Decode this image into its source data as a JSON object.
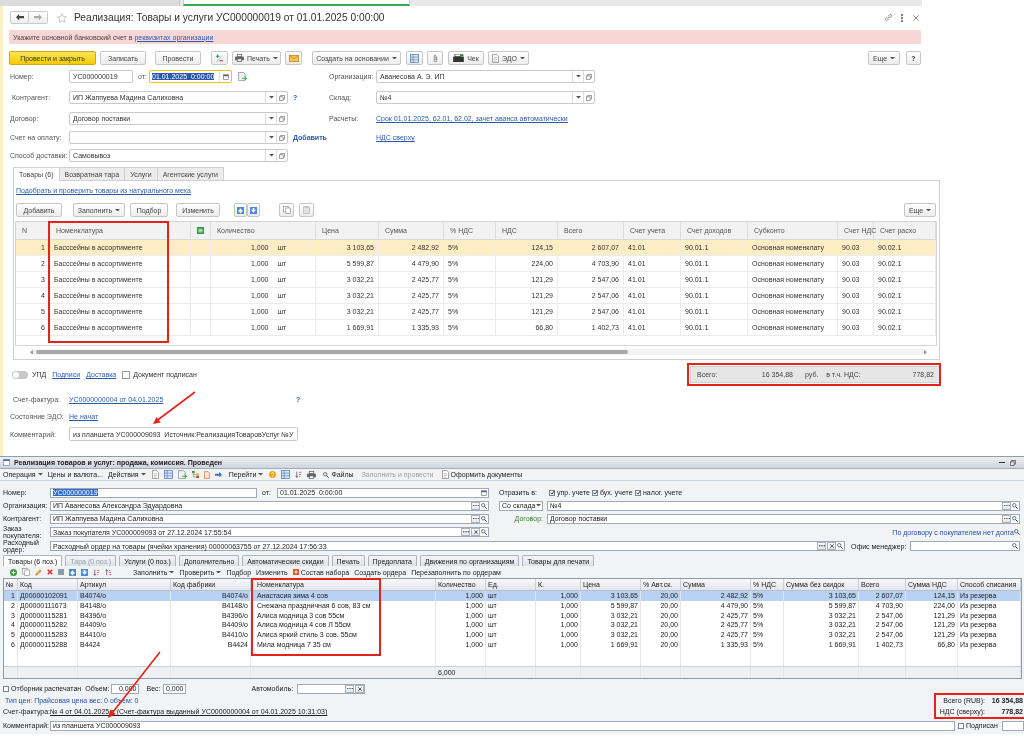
{
  "browser_tabs": [
    {
      "selected": false
    },
    {
      "selected": true
    }
  ],
  "document": {
    "title": "Реализация: Товары и услуги УС000000019 от 01.01.2025 0:00:00",
    "warning": {
      "text": "Укажите основной банковский счет в",
      "link": "реквизитах организации"
    },
    "toolbar": {
      "post_and_close": "Провести и закрыть",
      "save": "Записать",
      "post": "Провести",
      "print": "Печать",
      "create_based_on": "Создать на основании",
      "receipt": "Чек",
      "edo": "ЭДО",
      "more": "Еще",
      "help": "?"
    },
    "fields": {
      "number": {
        "label": "Номер:",
        "value": "УС000000019"
      },
      "date": {
        "label": "от:",
        "value": "01.01.2025  0:00:00",
        "focused": true
      },
      "organization": {
        "label": "Организация:",
        "value": "Аванесова А. Э. ИП"
      },
      "counterparty": {
        "label": "Контрагент:",
        "value": "ИП Жаппуева Мадина Салиховна",
        "help": "?"
      },
      "warehouse": {
        "label": "Склад:",
        "value": "№4"
      },
      "contract": {
        "label": "Договор:",
        "value": "Договор поставки"
      },
      "settlements": {
        "label": "Расчеты:",
        "link": "Срок 01.01.2025, 62.01, 62.02, зачет аванса автоматически"
      },
      "payment_invoice": {
        "label": "Счет на оплату:",
        "link": "Добавить"
      },
      "vat_mode_link": "НДС сверху",
      "delivery": {
        "label": "Способ доставки:",
        "value": "Самовывоз"
      }
    },
    "tabs": [
      {
        "label": "Товары (6)",
        "selected": true
      },
      {
        "label": "Возвратная тара",
        "selected": false
      },
      {
        "label": "Услуги",
        "selected": false
      },
      {
        "label": "Агентские услуги",
        "selected": false
      }
    ],
    "fur_link": "Подобрать и проверить товары из натурального меха",
    "table_toolbar": {
      "add": "Добавить",
      "fill": "Заполнить",
      "pick": "Подбор",
      "change": "Изменить",
      "more": "Еще"
    },
    "table": {
      "columns": [
        "N",
        "Номенклатура",
        "Количество",
        "Цена",
        "Сумма",
        "% НДС",
        "НДС",
        "Всего",
        "Счет учета",
        "Счет доходов",
        "Субконто",
        "Счет НДС",
        "Счет расхо"
      ],
      "rows": [
        {
          "selected": true,
          "cells": [
            "1",
            "Басссейны в ассортименте",
            "1,000 шт",
            "3 103,65",
            "2 482,92",
            "5%",
            "124,15",
            "2 607,07",
            "41.01",
            "90.01.1",
            "Основная номенклату",
            "90.03",
            "90.02.1"
          ]
        },
        {
          "selected": false,
          "cells": [
            "2",
            "Басссейны в ассортименте",
            "1,000 шт",
            "5 599,87",
            "4 479,90",
            "5%",
            "224,00",
            "4 703,90",
            "41.01",
            "90.01.1",
            "Основная номенклату",
            "90.03",
            "90.02.1"
          ]
        },
        {
          "selected": false,
          "cells": [
            "3",
            "Басссейны в ассортименте",
            "1,000 шт",
            "3 032,21",
            "2 425,77",
            "5%",
            "121,29",
            "2 547,06",
            "41.01",
            "90.01.1",
            "Основная номенклату",
            "90.03",
            "90.02.1"
          ]
        },
        {
          "selected": false,
          "cells": [
            "4",
            "Басссейны в ассортименте",
            "1,000 шт",
            "3 032,21",
            "2 425,77",
            "5%",
            "121,29",
            "2 547,06",
            "41.01",
            "90.01.1",
            "Основная номенклату",
            "90.03",
            "90.02.1"
          ]
        },
        {
          "selected": false,
          "cells": [
            "5",
            "Басссейны в ассортименте",
            "1,000 шт",
            "3 032,21",
            "2 425,77",
            "5%",
            "121,29",
            "2 547,06",
            "41.01",
            "90.01.1",
            "Основная номенклату",
            "90.03",
            "90.02.1"
          ]
        },
        {
          "selected": false,
          "cells": [
            "6",
            "Басссейны в ассортименте",
            "1,000 шт",
            "1 669,91",
            "1 335,93",
            "5%",
            "66,80",
            "1 402,73",
            "41.01",
            "90.01.1",
            "Основная номенклату",
            "90.03",
            "90.02.1"
          ]
        }
      ]
    },
    "upd": {
      "label": "УПД",
      "on": false
    },
    "signatures_link": "Подписи",
    "delivery_link": "Доставка",
    "signed": {
      "label": "Документ подписан",
      "checked": false
    },
    "totals": {
      "total_label": "Всего:",
      "total": "16 354,88",
      "currency": "руб.",
      "vat_label": "в т.ч. НДС:",
      "vat": "778,82"
    },
    "invoice": {
      "label": "Счет-фактура:",
      "link": "УС0000000004 от 04.01.2025",
      "help": "?"
    },
    "edo_status": {
      "label": "Состояние ЭДО:",
      "link": "Не начат"
    },
    "comment": {
      "label": "Комментарий:",
      "value": "из планшета УС000009093  Источник:РеализацияТоваровУслуг №У"
    }
  },
  "legacy_form": {
    "title": "Реализация товаров и услуг: продажа, комиссия. Проведен",
    "toolbar": {
      "operation": "Операция",
      "prices": "Цены и валюта...",
      "actions": "Действия",
      "go_to": "Перейти",
      "files": "Файлы",
      "fill_and_post": {
        "label": "Заполнить и провести",
        "disabled": true
      },
      "make_documents": "Оформить документы"
    },
    "fields": {
      "number": {
        "label": "Номер:",
        "value": "УС000000019",
        "focused": true
      },
      "date": {
        "label": "от:",
        "value": "01.01.2025  0:00:00"
      },
      "reflect": {
        "label": "Отразить в:",
        "options": [
          {
            "label": "упр. учете",
            "checked": true
          },
          {
            "label": "бух. учете",
            "checked": true
          },
          {
            "label": "налог. учете",
            "checked": true
          }
        ]
      },
      "organization": {
        "label": "Организация:",
        "value": "ИП Аванесова Александра Эдуардовна"
      },
      "warehouse": {
        "mode": "Со склада",
        "value": "№4"
      },
      "counterparty": {
        "label": "Контрагент:",
        "value": "ИП Жаппуева Мадина Салиховна"
      },
      "contract": {
        "label": "Договор:",
        "value": "Договор поставки"
      },
      "customer_order": {
        "label": "Заказ покупателя:",
        "value": "Заказ покупателя УС000009093 от 27.12.2024 17:55:54"
      },
      "debt_status": "По договору с покупателем нет долга",
      "expense_order": {
        "label": "Расходный ордер:",
        "value": "Расходный ордер на товары (ячейки хранения) 00000063755 от 27.12.2024 17:56:33"
      },
      "office_manager": {
        "label": "Офис менеджер:"
      }
    },
    "tabs": [
      {
        "label": "Товары (6 поз.)",
        "selected": true,
        "disabled": false
      },
      {
        "label": "Тара (0 поз.)",
        "selected": false,
        "disabled": true
      },
      {
        "label": "Услуги (0 поз.)",
        "selected": false,
        "disabled": false
      },
      {
        "label": "Дополнительно",
        "selected": false,
        "disabled": false
      },
      {
        "label": "Автоматические скидки",
        "selected": false,
        "disabled": false
      },
      {
        "label": "Печать",
        "selected": false,
        "disabled": false
      },
      {
        "label": "Предоплата",
        "selected": false,
        "disabled": false
      },
      {
        "label": "Движения по организациям",
        "selected": false,
        "disabled": false
      },
      {
        "label": "Товары для печати",
        "selected": false,
        "disabled": false
      }
    ],
    "table_toolbar": {
      "fill": "Заполнить",
      "check": "Проверить",
      "pick": "Подбор",
      "change": "Изменить",
      "kit": "Состав набора",
      "create_orders": "Создать ордера",
      "refill": "Перезаполнить по ордерам"
    },
    "table": {
      "columns": [
        "№",
        "Код",
        "Артикул",
        "Код фабрики",
        "Номенклатура",
        "Количество",
        "Ед.",
        "К.",
        "Цена",
        "% Авт.ск.",
        "Сумма",
        "% НДС",
        "Сумма без скидок",
        "Всего",
        "Сумма НДС",
        "Способ списания"
      ],
      "rows": [
        {
          "selected": true,
          "cells": [
            "1",
            "Д00000102091",
            "В4074/о",
            "В4074/о",
            "Анастасия зима 4 сов",
            "1,000",
            "шт",
            "1,000",
            "3 103,65",
            "20,00",
            "2 482,92",
            "5%",
            "3 103,65",
            "2 607,07",
            "124,15",
            "Из резерва"
          ]
        },
        {
          "selected": false,
          "cells": [
            "2",
            "Д00000111673",
            "В4148/о",
            "В4148/о",
            "Снежана праздничная 6 сов, 83 см",
            "1,000",
            "шт",
            "1,000",
            "5 599,87",
            "20,00",
            "4 479,90",
            "5%",
            "5 599,87",
            "4 703,90",
            "224,00",
            "Из резерва"
          ]
        },
        {
          "selected": false,
          "cells": [
            "3",
            "Д00000115281",
            "В4396/о",
            "В4396/о",
            "Алиса модница 3 сов 55см",
            "1,000",
            "шт",
            "1,000",
            "3 032,21",
            "20,00",
            "2 425,77",
            "5%",
            "3 032,21",
            "2 547,06",
            "121,29",
            "Из резерва"
          ]
        },
        {
          "selected": false,
          "cells": [
            "4",
            "Д00000115282",
            "В4409/о",
            "В4409/о",
            "Алиса модница 4 сов Л 55см",
            "1,000",
            "шт",
            "1,000",
            "3 032,21",
            "20,00",
            "2 425,77",
            "5%",
            "3 032,21",
            "2 547,06",
            "121,29",
            "Из резерва"
          ]
        },
        {
          "selected": false,
          "cells": [
            "5",
            "Д00000115283",
            "В4410/о",
            "В4410/о",
            "Алиса яркий стиль 3 сов. 55см",
            "1,000",
            "шт",
            "1,000",
            "3 032,21",
            "20,00",
            "2 425,77",
            "5%",
            "3 032,21",
            "2 547,06",
            "121,29",
            "Из резерва"
          ]
        },
        {
          "selected": false,
          "cells": [
            "6",
            "Д00000115288",
            "В4424",
            "В4424",
            "Мила модница 7 35 см",
            "1,000",
            "шт",
            "1,000",
            "1 669,91",
            "20,00",
            "1 335,93",
            "5%",
            "1 669,91",
            "1 402,73",
            "66,80",
            "Из резерва"
          ]
        }
      ],
      "total_quantity": "6,000"
    },
    "picker_printed": {
      "label": "Отборник распечатан",
      "checked": false
    },
    "volume": {
      "label": "Объем:",
      "value": "0,000"
    },
    "weight": {
      "label": "Вес:",
      "value": "0,000"
    },
    "vehicle": {
      "label": "Автомобиль:"
    },
    "price_type": "Тип цен: Прайсовая цена вес: 0 объем: 0",
    "invoice": {
      "label": "Счет-фактура:",
      "link": "№ 4 от 04.01.2025 г. (Счет-фактура выданный УС0000000004 от 04.01.2025 10:31:03)"
    },
    "totals": [
      {
        "label": "Всего (RUB):",
        "value": "16 354,88"
      },
      {
        "label": "НДС (сверху):",
        "value": "778,82"
      }
    ],
    "comment": {
      "label": "Комментарий:",
      "value": "из планшета УС000009093"
    },
    "signed": {
      "label": "Подписан",
      "checked": false
    }
  }
}
